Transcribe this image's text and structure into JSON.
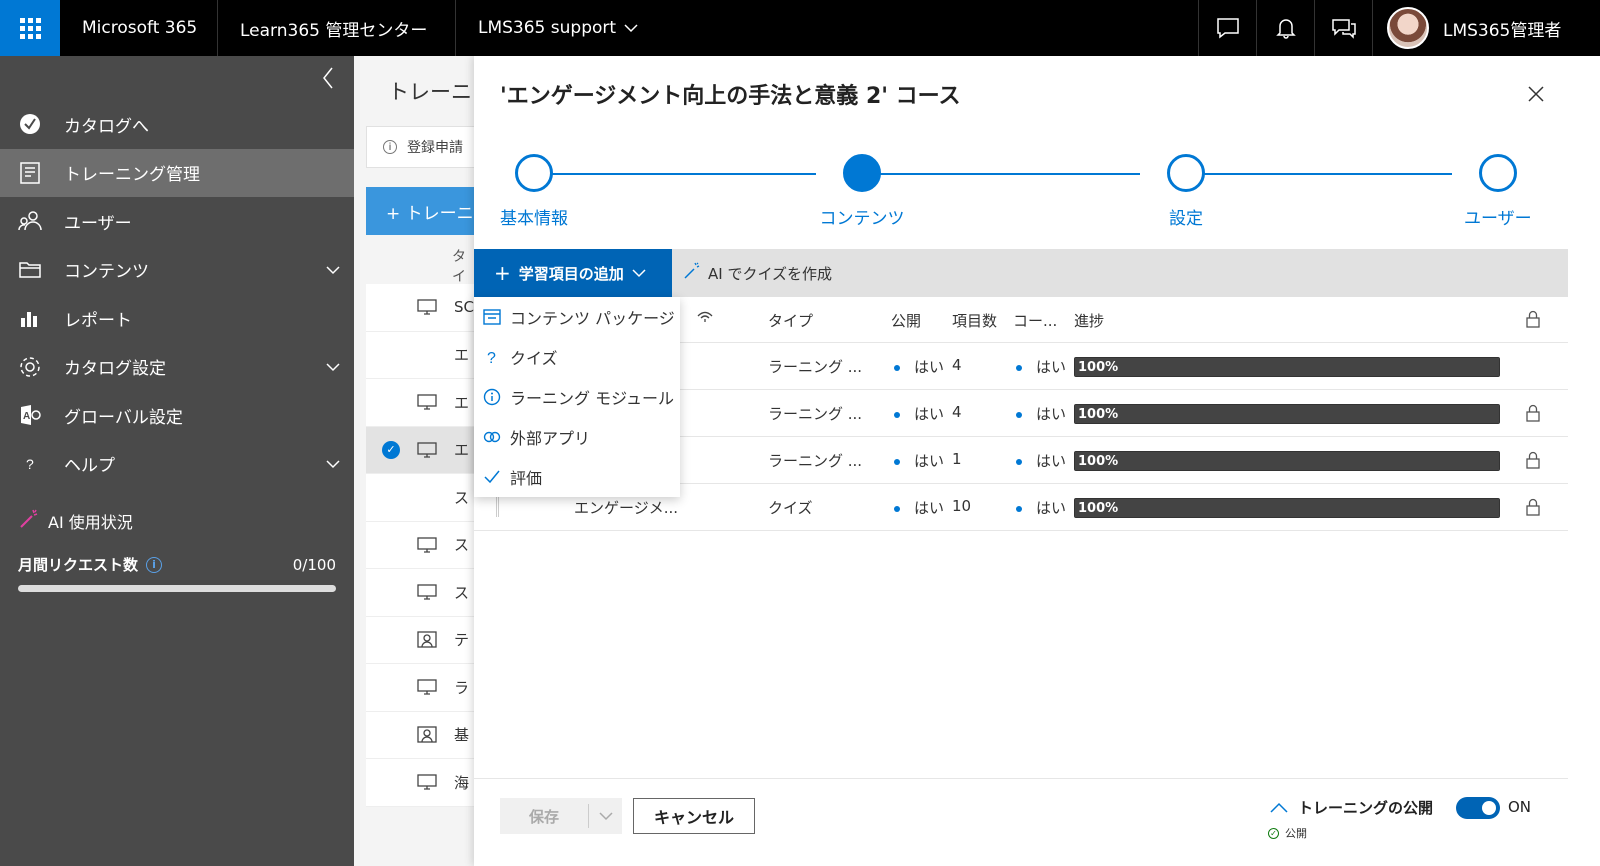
{
  "topbar": {
    "brand": "Microsoft 365",
    "app": "Learn365 管理センター",
    "org": "LMS365 support",
    "user": "LMS365管理者",
    "icons": [
      "chat-icon",
      "bell-icon",
      "feedback-icon"
    ]
  },
  "leftnav": {
    "items": [
      {
        "label": "カタログへ",
        "icon": "checkmark-circle-icon",
        "expandable": false,
        "active": false
      },
      {
        "label": "トレーニング管理",
        "icon": "training-icon",
        "expandable": false,
        "active": true
      },
      {
        "label": "ユーザー",
        "icon": "users-icon",
        "expandable": false,
        "active": false
      },
      {
        "label": "コンテンツ",
        "icon": "folder-icon",
        "expandable": true,
        "active": false
      },
      {
        "label": "レポート",
        "icon": "chart-icon",
        "expandable": false,
        "active": false
      },
      {
        "label": "カタログ設定",
        "icon": "gear-icon",
        "expandable": true,
        "active": false
      },
      {
        "label": "グローバル設定",
        "icon": "global-settings-icon",
        "expandable": false,
        "active": false
      },
      {
        "label": "ヘルプ",
        "icon": "help-icon",
        "expandable": true,
        "active": false
      }
    ],
    "ai_usage": "AI 使用状況",
    "monthly_requests_label": "月間リクエスト数",
    "monthly_requests_value": "0/100",
    "monthly_requests_fraction": 0
  },
  "midpane": {
    "title": "トレーニング",
    "notice": "登録申請",
    "add_button": "+ トレーニング",
    "column_header": "タイ",
    "rows": [
      {
        "text": "SC",
        "icon": "monitor-icon",
        "selected": false
      },
      {
        "text": "エ",
        "icon": "folder-icon",
        "selected": false
      },
      {
        "text": "エ",
        "icon": "monitor-icon",
        "selected": false
      },
      {
        "text": "エ",
        "icon": "monitor-icon",
        "selected": true
      },
      {
        "text": "ス",
        "icon": "folder-icon",
        "selected": false
      },
      {
        "text": "ス",
        "icon": "monitor-icon",
        "selected": false
      },
      {
        "text": "ス",
        "icon": "monitor-icon",
        "selected": false
      },
      {
        "text": "テ",
        "icon": "classroom-icon",
        "selected": false
      },
      {
        "text": "ラ",
        "icon": "monitor-icon",
        "selected": false
      },
      {
        "text": "基",
        "icon": "classroom-icon",
        "selected": false
      },
      {
        "text": "海",
        "icon": "monitor-icon",
        "selected": false
      }
    ]
  },
  "panel": {
    "title": "'エンゲージメント向上の手法と意義 2' コース",
    "steps": [
      "基本情報",
      "コンテンツ",
      "設定",
      "ユーザー"
    ],
    "current_step": 1,
    "add_button": "学習項目の追加",
    "ai_quiz": "AI でクイズを作成",
    "dropdown": [
      {
        "label": "コンテンツ パッケージ",
        "icon": "package-icon"
      },
      {
        "label": "クイズ",
        "icon": "question-icon"
      },
      {
        "label": "ラーニング モジュール",
        "icon": "info-icon"
      },
      {
        "label": "外部アプリ",
        "icon": "link-icon"
      },
      {
        "label": "評価",
        "icon": "check-icon"
      }
    ],
    "table": {
      "headers": {
        "type": "タイプ",
        "published": "公開",
        "items": "項目数",
        "course": "コー...",
        "progress": "進捗"
      },
      "rows": [
        {
          "title": "",
          "type": "ラーニング ...",
          "published": "はい",
          "items": "4",
          "course": "はい",
          "progress": "100%",
          "progress_value": 100,
          "locked": false
        },
        {
          "title": "",
          "type": "ラーニング ...",
          "published": "はい",
          "items": "4",
          "course": "はい",
          "progress": "100%",
          "progress_value": 100,
          "locked": true
        },
        {
          "title": "",
          "type": "ラーニング ...",
          "published": "はい",
          "items": "1",
          "course": "はい",
          "progress": "100%",
          "progress_value": 100,
          "locked": true
        },
        {
          "title": "エンゲージメ...",
          "type": "クイズ",
          "published": "はい",
          "items": "10",
          "course": "はい",
          "progress": "100%",
          "progress_value": 100,
          "locked": true
        }
      ]
    },
    "footer": {
      "save": "保存",
      "cancel": "キャンセル",
      "publish_label": "トレーニングの公開",
      "toggle_label": "ON",
      "status": "公開"
    }
  },
  "colors": {
    "accent": "#0078d4",
    "nav_bg": "#4a4a4a",
    "topbar_bg": "#000000"
  }
}
